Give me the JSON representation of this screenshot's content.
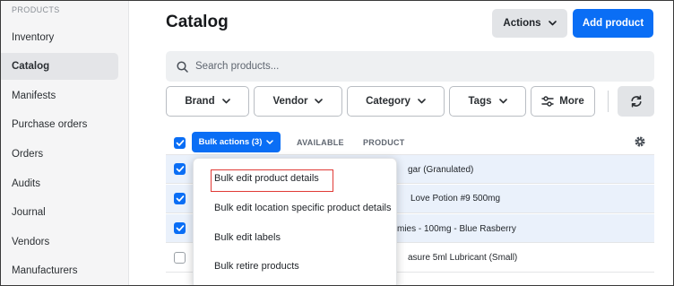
{
  "sidebar": {
    "section_label": "PRODUCTS",
    "items": [
      {
        "label": "Inventory",
        "active": false
      },
      {
        "label": "Catalog",
        "active": true
      },
      {
        "label": "Manifests",
        "active": false
      },
      {
        "label": "Purchase orders",
        "active": false
      },
      {
        "label": "Orders",
        "active": false
      },
      {
        "label": "Audits",
        "active": false
      },
      {
        "label": "Journal",
        "active": false
      },
      {
        "label": "Vendors",
        "active": false
      },
      {
        "label": "Manufacturers",
        "active": false
      }
    ]
  },
  "header": {
    "title": "Catalog",
    "actions_label": "Actions",
    "add_label": "Add product"
  },
  "search": {
    "placeholder": "Search products...",
    "value": ""
  },
  "filters": {
    "brand": "Brand",
    "vendor": "Vendor",
    "category": "Category",
    "tags": "Tags",
    "more": "More"
  },
  "table": {
    "select_all_checked": true,
    "bulk_label": "Bulk actions (3)",
    "columns": {
      "available": "AVAILABLE",
      "product": "PRODUCT"
    },
    "rows": [
      {
        "checked": true,
        "text": "gar (Granulated)"
      },
      {
        "checked": true,
        "text": "Love Potion #9 500mg"
      },
      {
        "checked": true,
        "text": "mies - 100mg - Blue Rasberry"
      },
      {
        "checked": false,
        "text": "asure 5ml Lubricant (Small)"
      }
    ]
  },
  "bulk_menu": {
    "items": [
      "Bulk edit product details",
      "Bulk edit location specific product details",
      "Bulk edit labels",
      "Bulk retire products"
    ],
    "highlighted_index": 0
  },
  "colors": {
    "accent": "#0a6ef5",
    "highlight": "#e03a36",
    "selected_row": "#eaf1fb"
  },
  "icons": {
    "search": "search-icon",
    "chevron": "chevron-down-icon",
    "sliders": "sliders-icon",
    "refresh": "refresh-icon",
    "settings": "gear-icon",
    "check": "check-icon"
  }
}
